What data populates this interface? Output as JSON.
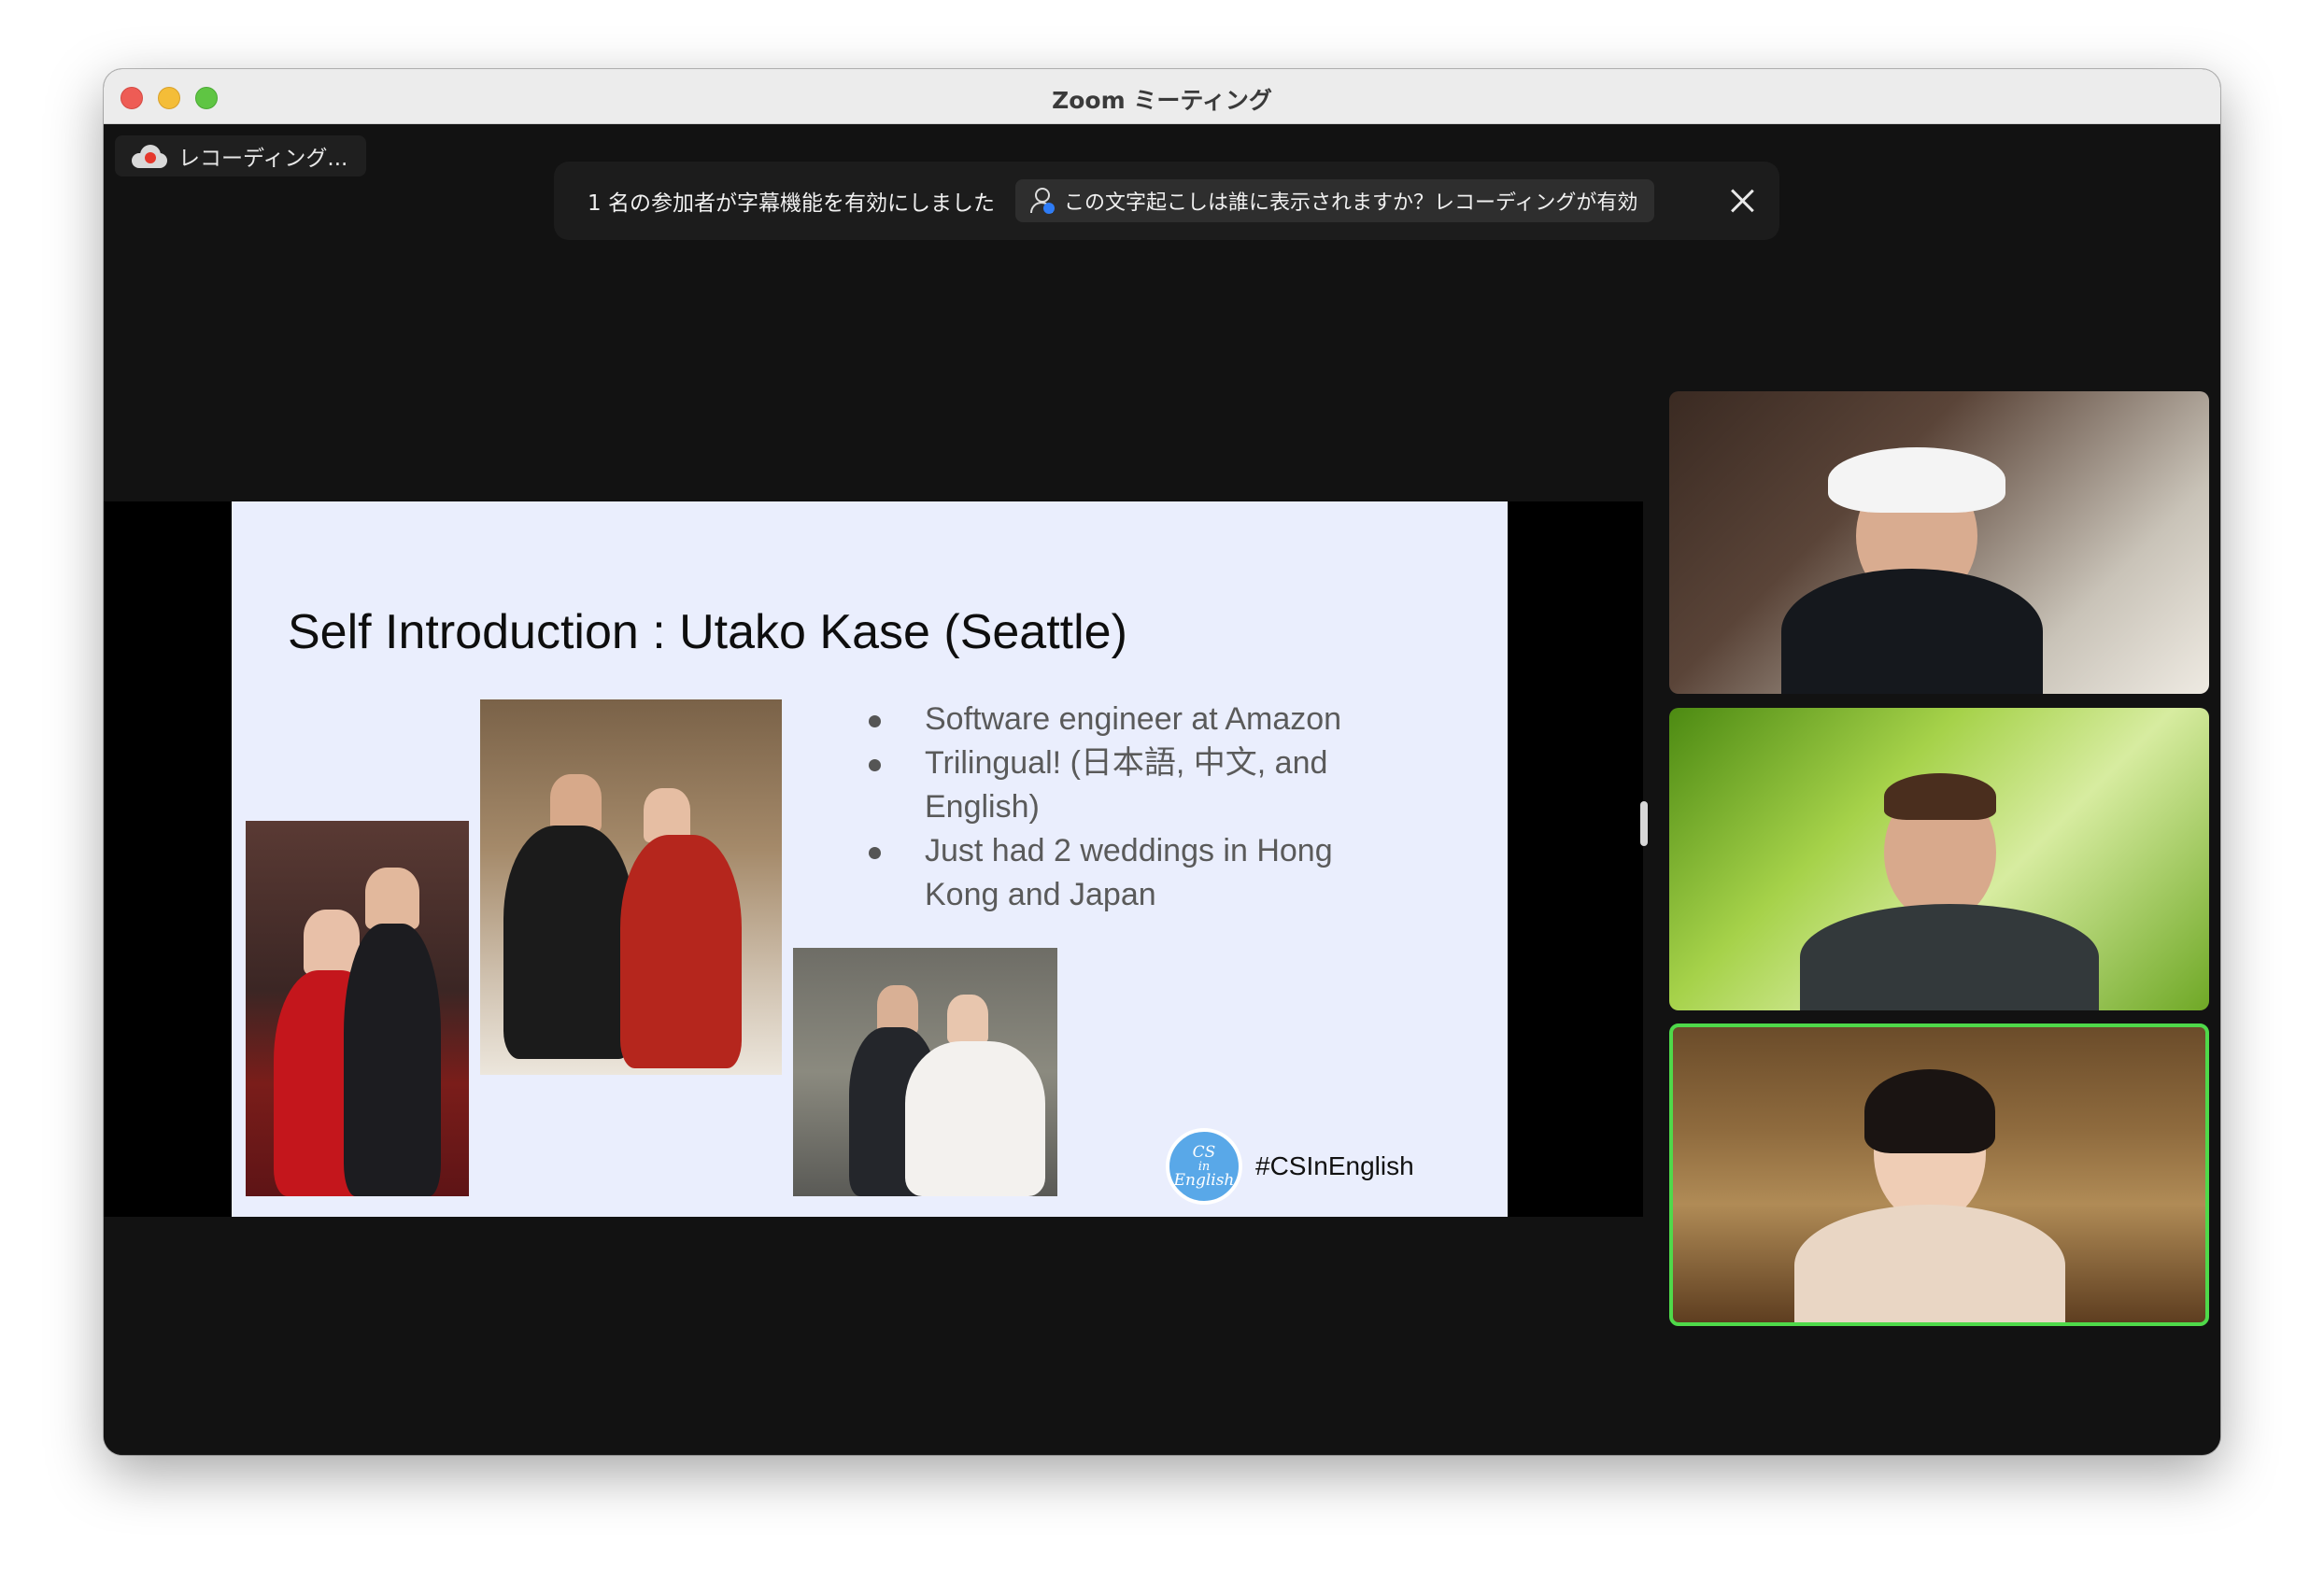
{
  "window": {
    "title": "Zoom ミーティング"
  },
  "recording": {
    "label": "レコーディング..."
  },
  "caption_banner": {
    "message": "1 名の参加者が字幕機能を有効にしました",
    "link_text": "この文字起こしは誰に表示されますか？レコーディングが有効"
  },
  "slide": {
    "title": "Self Introduction : Utako Kase (Seattle)",
    "bullets": [
      "Software engineer at Amazon",
      "Trilingual! (日本語, 中文, and English)",
      "Just had 2 weddings in Hong Kong and Japan"
    ],
    "logo_text": [
      "CS",
      "in",
      "English"
    ],
    "hashtag": "#CSInEnglish"
  },
  "participants": [
    {
      "tile": 1,
      "active_speaker": false
    },
    {
      "tile": 2,
      "active_speaker": false
    },
    {
      "tile": 3,
      "active_speaker": true
    }
  ],
  "colors": {
    "active_speaker_border": "#4fd94a",
    "slide_background": "#eaeefd",
    "meeting_background": "#121212"
  }
}
